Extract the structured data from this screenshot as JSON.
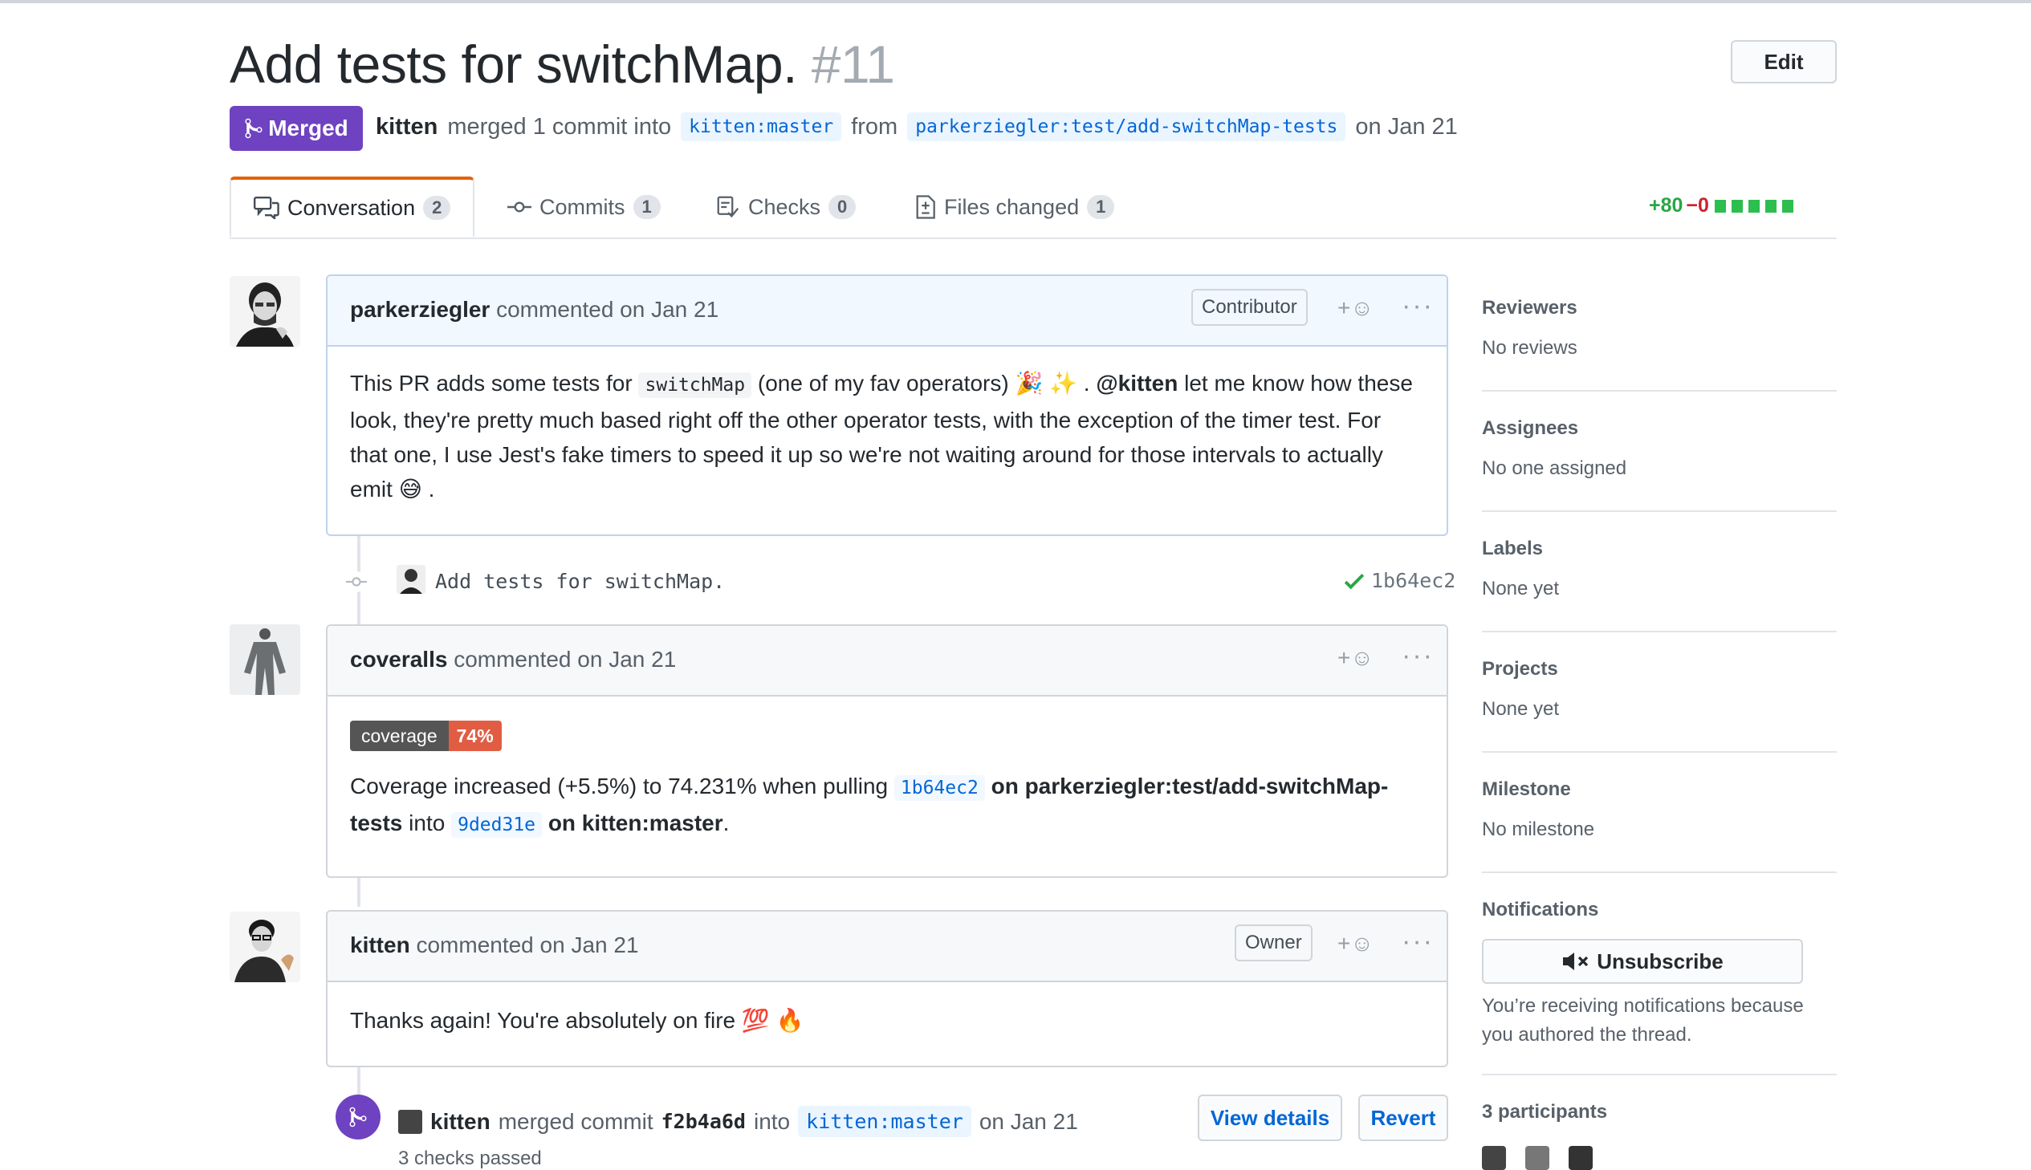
{
  "header": {
    "title": "Add tests for switchMap.",
    "number": "#11",
    "edit_label": "Edit",
    "state": "Merged",
    "author": "kitten",
    "action": "merged 1 commit into",
    "base_branch": "kitten:master",
    "from_word": "from",
    "head_branch": "parkerziegler:test/add-switchMap-tests",
    "date": "on Jan 21"
  },
  "tabs": [
    {
      "label": "Conversation",
      "count": "2",
      "icon": "comment-discussion-icon",
      "active": true
    },
    {
      "label": "Commits",
      "count": "1",
      "icon": "commit-icon"
    },
    {
      "label": "Checks",
      "count": "0",
      "icon": "checklist-icon"
    },
    {
      "label": "Files changed",
      "count": "1",
      "icon": "file-diff-icon"
    }
  ],
  "diffstat": {
    "additions": "+80",
    "deletions": "−0"
  },
  "comments": [
    {
      "author": "parkerziegler",
      "meta": "commented on Jan 21",
      "role": "Contributor",
      "body": {
        "p1": "This PR adds some tests for",
        "code": "switchMap",
        "p2": "(one of my fav operators)",
        "p3": ".",
        "mention": "@kitten",
        "p4": "let me know how these look, they're pretty much based right off the other operator tests, with the exception of the timer test. For that one, I use Jest's fake timers to speed it up so we're not waiting around for those intervals to actually emit",
        "p5": "."
      }
    },
    {
      "author": "coveralls",
      "meta": "commented on Jan 21",
      "badge_label": "coverage",
      "badge_value": "74%",
      "body": {
        "p1": "Coverage increased (+5.5%) to 74.231% when pulling",
        "sha1": "1b64ec2",
        "p2": "on parkerziegler:test/add-switchMap-tests",
        "p3": "into",
        "sha2": "9ded31e",
        "p4": "on kitten:master",
        "p5": "."
      }
    },
    {
      "author": "kitten",
      "meta": "commented on Jan 21",
      "role": "Owner",
      "body": {
        "p1": "Thanks again! You're absolutely on fire"
      }
    }
  ],
  "commit": {
    "message": "Add tests for switchMap.",
    "sha": "1b64ec2"
  },
  "merge_event": {
    "author": "kitten",
    "action": "merged commit",
    "sha": "f2b4a6d",
    "into": "into",
    "branch": "kitten:master",
    "date": "on Jan 21",
    "view_details": "View details",
    "revert": "Revert",
    "checks": "3 checks passed"
  },
  "sidebar": {
    "reviewers": {
      "title": "Reviewers",
      "value": "No reviews"
    },
    "assignees": {
      "title": "Assignees",
      "value": "No one assigned"
    },
    "labels": {
      "title": "Labels",
      "value": "None yet"
    },
    "projects": {
      "title": "Projects",
      "value": "None yet"
    },
    "milestone": {
      "title": "Milestone",
      "value": "No milestone"
    },
    "notifications": {
      "title": "Notifications",
      "button": "Unsubscribe",
      "notice": "You’re receiving notifications because you authored the thread."
    },
    "participants": "3 participants"
  },
  "colors": {
    "merged": "#6f42c1",
    "add": "#28a745",
    "del": "#cb2431",
    "link": "#0366d6",
    "coverage_value": "#e05d44"
  },
  "emoji": {
    "party": "🎉",
    "sparkles": "✨",
    "sweat_smile": "😅",
    "hundred": "💯",
    "fire": "🔥"
  }
}
